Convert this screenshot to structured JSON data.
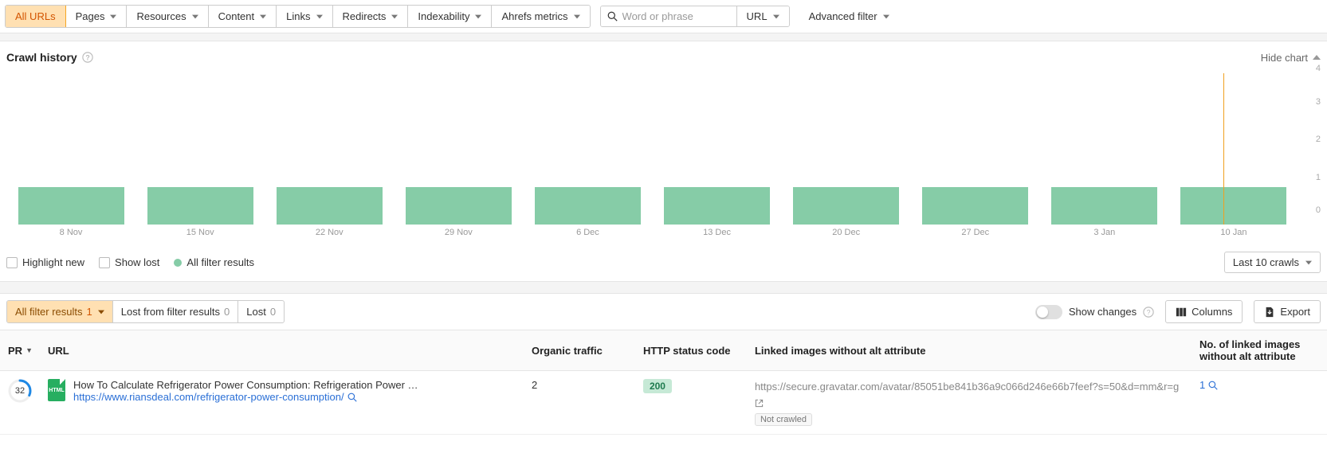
{
  "filters": {
    "all_urls": "All URLs",
    "pages": "Pages",
    "resources": "Resources",
    "content": "Content",
    "links": "Links",
    "redirects": "Redirects",
    "indexability": "Indexability",
    "ahrefs_metrics": "Ahrefs metrics"
  },
  "search": {
    "placeholder": "Word or phrase",
    "scope_label": "URL"
  },
  "advanced_filter_label": "Advanced filter",
  "crawl_history": {
    "title": "Crawl history",
    "hide_chart": "Hide chart"
  },
  "chart_data": {
    "type": "bar",
    "categories": [
      "8 Nov",
      "15 Nov",
      "22 Nov",
      "29 Nov",
      "6 Dec",
      "13 Dec",
      "20 Dec",
      "27 Dec",
      "3 Jan",
      "10 Jan"
    ],
    "values": [
      1,
      1,
      1,
      1,
      1,
      1,
      1,
      1,
      1,
      1
    ],
    "ylim": [
      0,
      4
    ],
    "yticks": [
      0,
      1,
      2,
      3,
      4
    ],
    "marker_at_index": 9
  },
  "chart_legend": {
    "highlight_new": "Highlight new",
    "show_lost": "Show lost",
    "all_filter_results": "All filter results"
  },
  "range_selector": "Last 10 crawls",
  "results_toolbar": {
    "all_filter_results_label": "All filter results",
    "all_filter_results_count": "1",
    "lost_from_filter_label": "Lost from filter results",
    "lost_from_filter_count": "0",
    "lost_label": "Lost",
    "lost_count": "0",
    "show_changes": "Show changes",
    "columns": "Columns",
    "export": "Export"
  },
  "table": {
    "headers": {
      "pr": "PR",
      "url": "URL",
      "organic_traffic": "Organic traffic",
      "http_status": "HTTP status code",
      "linked_no_alt": "Linked images without alt attribute",
      "count_no_alt": "No. of linked images without alt attribute"
    },
    "rows": [
      {
        "pr": "32",
        "icon_label": "HTML",
        "title": "How To Calculate Refrigerator Power Consumption: Refrigeration Power …",
        "url": "https://www.riansdeal.com/refrigerator-power-consumption/",
        "organic_traffic": "2",
        "http_status": "200",
        "linked_image_url": "https://secure.gravatar.com/avatar/85051be841b36a9c066d246e66b7feef?s=50&d=mm&r=g",
        "linked_status": "Not crawled",
        "count": "1"
      }
    ]
  }
}
